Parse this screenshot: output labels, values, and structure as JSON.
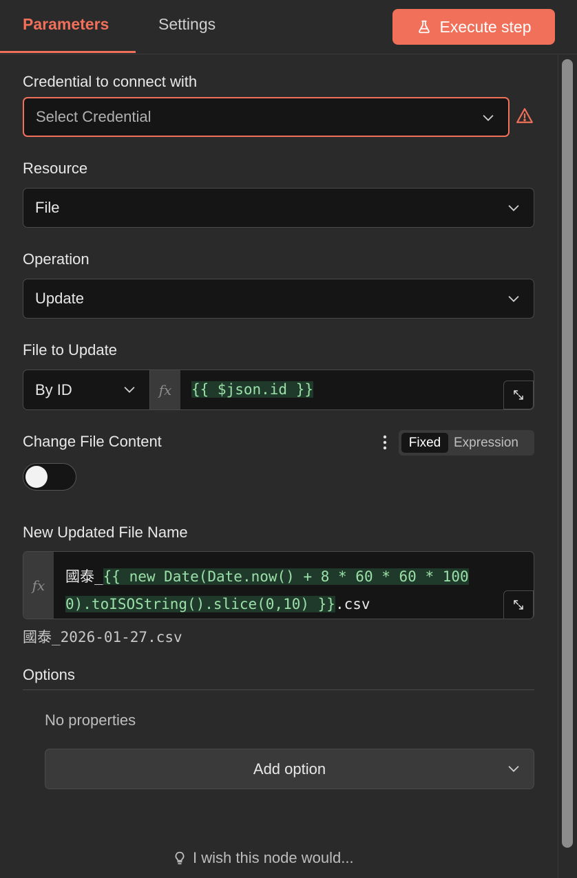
{
  "tabs": {
    "parameters": "Parameters",
    "settings": "Settings"
  },
  "execute_button": "Execute step",
  "credential": {
    "label": "Credential to connect with",
    "placeholder": "Select Credential"
  },
  "resource": {
    "label": "Resource",
    "value": "File"
  },
  "operation": {
    "label": "Operation",
    "value": "Update"
  },
  "file_to_update": {
    "label": "File to Update",
    "mode": "By ID",
    "fx": "fx",
    "expression": "{{ $json.id }}"
  },
  "change_content": {
    "label": "Change File Content",
    "toggle_fixed": "Fixed",
    "toggle_expression": "Expression",
    "enabled": false
  },
  "new_file_name": {
    "label": "New Updated File Name",
    "fx": "fx",
    "prefix": "國泰_",
    "expr_line1": "{{ new Date(Date.now() + 8 * 60 * 60 * 100",
    "expr_line2": "0).toISOString().slice(0,10) }}",
    "suffix": ".csv",
    "preview": "國泰_2026-01-27.csv"
  },
  "options": {
    "heading": "Options",
    "empty": "No properties",
    "add_button": "Add option"
  },
  "feedback": "I wish this node would...",
  "colors": {
    "accent": "#f0705a",
    "background": "#2a2a2a",
    "input_bg": "#151515",
    "expression_highlight": "#9be0a8"
  }
}
